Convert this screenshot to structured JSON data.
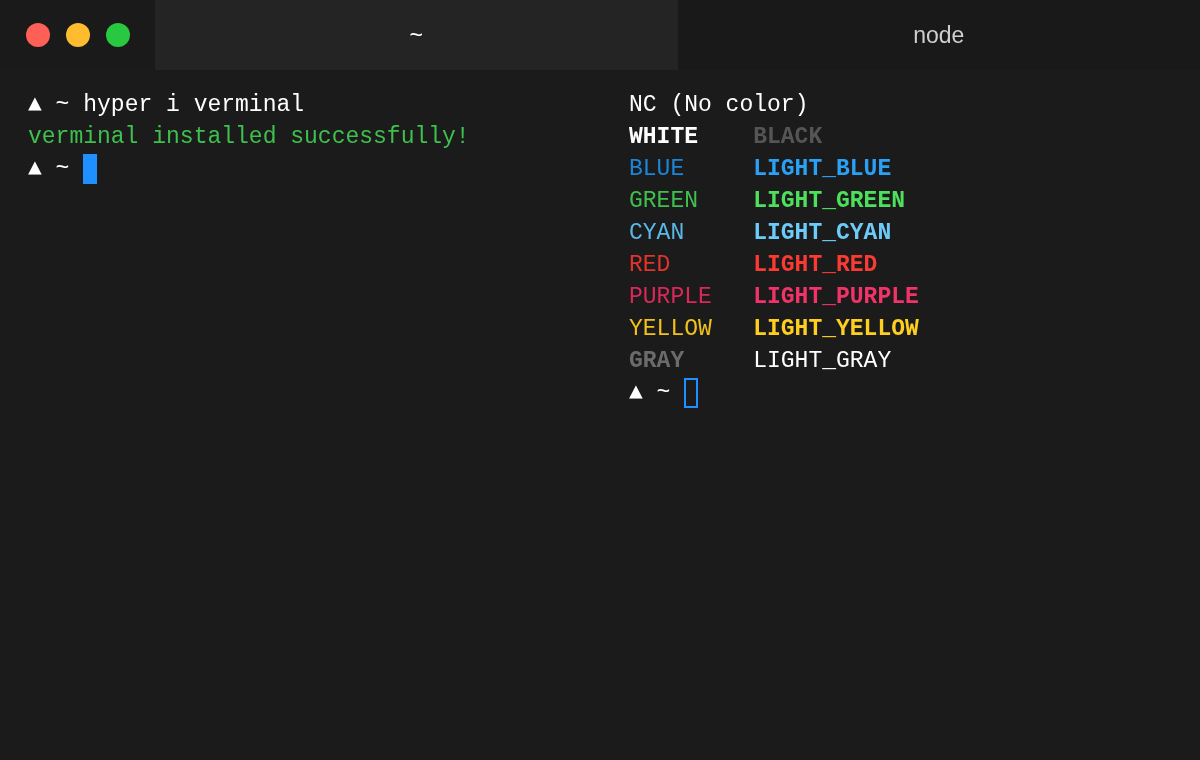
{
  "window": {
    "controls": [
      {
        "color": "#fe5f57"
      },
      {
        "color": "#febc2e"
      },
      {
        "color": "#28c840"
      }
    ]
  },
  "tabs": [
    {
      "label": "~",
      "selected": true
    },
    {
      "label": "node",
      "selected": false
    }
  ],
  "panes": [
    {
      "lines": [
        {
          "kind": "prompt",
          "segments": [
            {
              "text": "▲ ~",
              "color": "#ffffff",
              "bold": false
            },
            {
              "text": "hyper i verminal",
              "color": "#ffffff",
              "bold": false
            }
          ]
        },
        {
          "kind": "text",
          "segments": [
            {
              "text": "verminal installed successfully!",
              "color": "#3fc04e",
              "bold": false
            }
          ]
        },
        {
          "kind": "prompt",
          "segments": [
            {
              "text": "▲ ~",
              "color": "#ffffff",
              "bold": false
            }
          ],
          "cursor": {
            "focused": true
          }
        }
      ]
    },
    {
      "lines": [
        {
          "kind": "text",
          "segments": [
            {
              "text": "NC (No color)",
              "color": "#ffffff",
              "bold": false
            }
          ]
        },
        {
          "kind": "row",
          "segments": [
            {
              "text": "WHITE",
              "color": "#ffffff",
              "bold": true
            },
            {
              "text": "BLACK",
              "color": "#555555",
              "bold": true
            }
          ]
        },
        {
          "kind": "row",
          "segments": [
            {
              "text": "BLUE",
              "color": "#1a86d9",
              "bold": false
            },
            {
              "text": "LIGHT_BLUE",
              "color": "#2aa1f5",
              "bold": true
            }
          ]
        },
        {
          "kind": "row",
          "segments": [
            {
              "text": "GREEN",
              "color": "#3fc04e",
              "bold": false
            },
            {
              "text": "LIGHT_GREEN",
              "color": "#4de05c",
              "bold": true
            }
          ]
        },
        {
          "kind": "row",
          "segments": [
            {
              "text": "CYAN",
              "color": "#5ab8e8",
              "bold": false
            },
            {
              "text": "LIGHT_CYAN",
              "color": "#6ccbf7",
              "bold": true
            }
          ]
        },
        {
          "kind": "row",
          "segments": [
            {
              "text": "RED",
              "color": "#e3342c",
              "bold": false
            },
            {
              "text": "LIGHT_RED",
              "color": "#fa3a33",
              "bold": true
            }
          ]
        },
        {
          "kind": "row",
          "segments": [
            {
              "text": "PURPLE",
              "color": "#d9285a",
              "bold": false
            },
            {
              "text": "LIGHT_PURPLE",
              "color": "#f2336a",
              "bold": true
            }
          ]
        },
        {
          "kind": "row",
          "segments": [
            {
              "text": "YELLOW",
              "color": "#f0c21a",
              "bold": false
            },
            {
              "text": "LIGHT_YELLOW",
              "color": "#ffcf1f",
              "bold": true
            }
          ]
        },
        {
          "kind": "row",
          "segments": [
            {
              "text": "GRAY",
              "color": "#6b6b6b",
              "bold": true
            },
            {
              "text": "LIGHT_GRAY",
              "color": "#ffffff",
              "bold": false
            }
          ]
        },
        {
          "kind": "prompt",
          "segments": [
            {
              "text": "▲ ~",
              "color": "#ffffff",
              "bold": false
            }
          ],
          "cursor": {
            "focused": false
          }
        }
      ]
    }
  ]
}
